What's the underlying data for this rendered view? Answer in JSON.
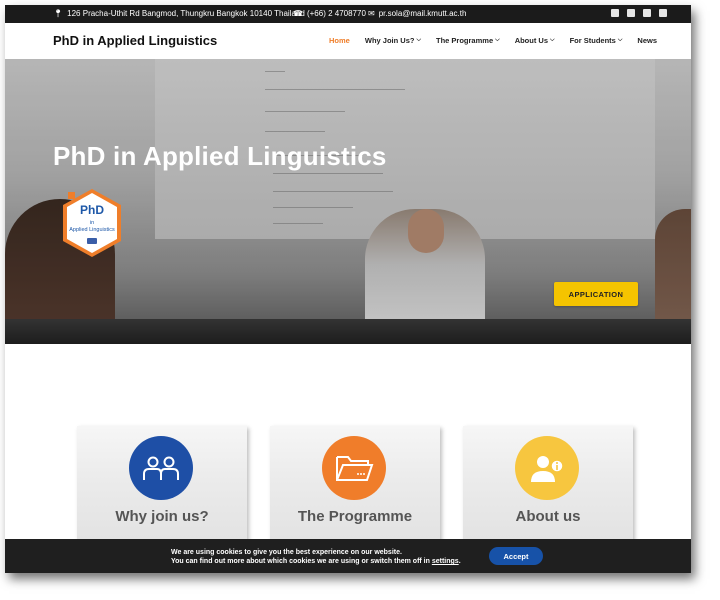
{
  "topbar": {
    "address": "126 Pracha-Uthit Rd Bangmod, Thungkru Bangkok 10140 Thailand",
    "phone": "(+66) 2 4708770",
    "email": "pr.sola@mail.kmutt.ac.th",
    "icons": [
      "map-pin-icon",
      "phone-icon",
      "envelope-icon",
      "facebook-icon",
      "twitter-icon",
      "youtube-icon",
      "mail-icon"
    ]
  },
  "nav": {
    "site_title": "PhD in Applied Linguistics",
    "items": [
      {
        "label": "Home",
        "active": true
      },
      {
        "label": "Why Join Us?",
        "dropdown": true
      },
      {
        "label": "The Programme",
        "dropdown": true
      },
      {
        "label": "About Us",
        "dropdown": true
      },
      {
        "label": "For Students",
        "dropdown": true
      },
      {
        "label": "News"
      }
    ],
    "active_color": "#ef7e2a"
  },
  "hero": {
    "title": "PhD in Applied Linguistics",
    "badge": {
      "line1": "PhD",
      "line2": "in",
      "line3": "Applied Linguistics"
    },
    "cta_label": "APPLICATION",
    "cta_color": "#f5c400"
  },
  "cards": [
    {
      "title": "Why join us?",
      "icon": "people-icon",
      "color": "#1e4fa6"
    },
    {
      "title": "The Programme",
      "icon": "folder-icon",
      "color": "#f07d2a"
    },
    {
      "title": "About us",
      "icon": "user-info-icon",
      "color": "#f7c63f"
    }
  ],
  "cookie": {
    "line1": "We are using cookies to give you the best experience on our website.",
    "line2_prefix": "You can find out more about which cookies we are using or switch them off in ",
    "line2_link": "settings",
    "line2_suffix": ".",
    "accept_label": "Accept"
  }
}
